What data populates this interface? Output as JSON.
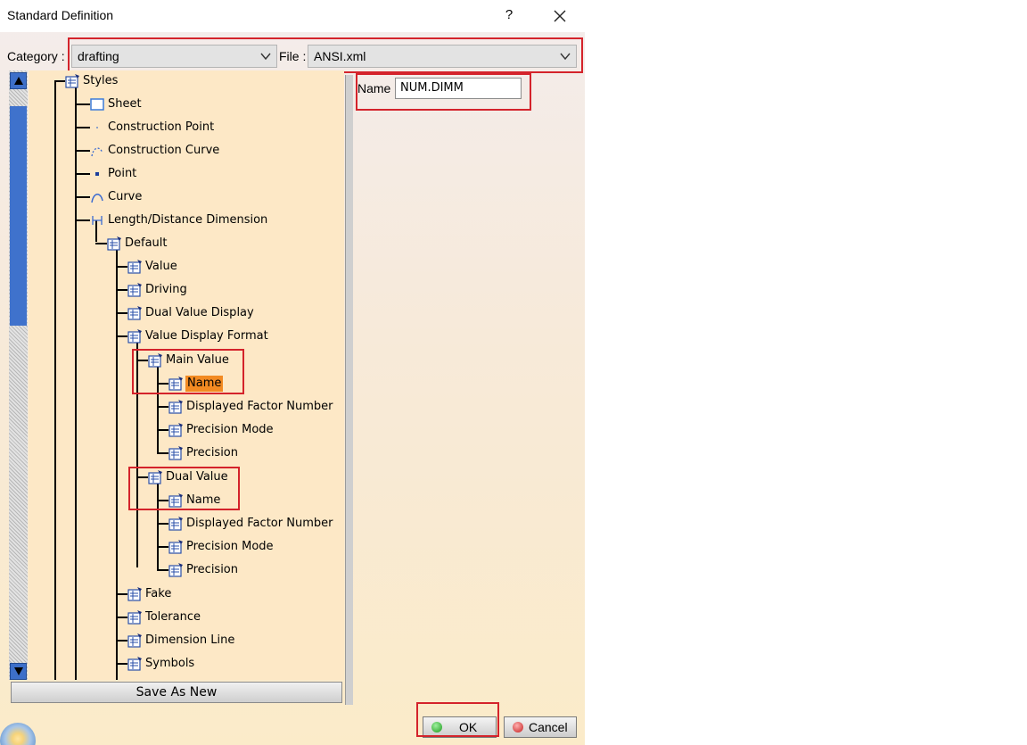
{
  "window": {
    "title": "Standard Definition",
    "help_glyph": "?"
  },
  "header": {
    "category_label": "Category :",
    "category_value": "drafting",
    "file_label": "File :",
    "file_value": "ANSI.xml"
  },
  "tree": {
    "items": [
      {
        "label": "Styles"
      },
      {
        "label": "Sheet"
      },
      {
        "label": "Construction Point"
      },
      {
        "label": "Construction Curve"
      },
      {
        "label": "Point"
      },
      {
        "label": "Curve"
      },
      {
        "label": "Length/Distance Dimension"
      },
      {
        "label": "Default"
      },
      {
        "label": "Value"
      },
      {
        "label": "Driving"
      },
      {
        "label": "Dual Value Display"
      },
      {
        "label": "Value Display Format"
      },
      {
        "label": "Main Value"
      },
      {
        "label": "Name"
      },
      {
        "label": "Displayed Factor Number"
      },
      {
        "label": "Precision Mode"
      },
      {
        "label": "Precision"
      },
      {
        "label": "Dual Value"
      },
      {
        "label": "Name"
      },
      {
        "label": "Displayed Factor Number"
      },
      {
        "label": "Precision Mode"
      },
      {
        "label": "Precision"
      },
      {
        "label": "Fake"
      },
      {
        "label": "Tolerance"
      },
      {
        "label": "Dimension Line"
      },
      {
        "label": "Symbols"
      }
    ],
    "selected": "Name",
    "save_as_new": "Save As New"
  },
  "detail": {
    "name_label": "Name",
    "name_value": "NUM.DIMM"
  },
  "footer": {
    "ok_label": "OK",
    "cancel_label": "Cancel"
  },
  "colors": {
    "highlight": "#d4232b",
    "selection": "#f28a22",
    "scroll_thumb": "#3f72cc"
  }
}
